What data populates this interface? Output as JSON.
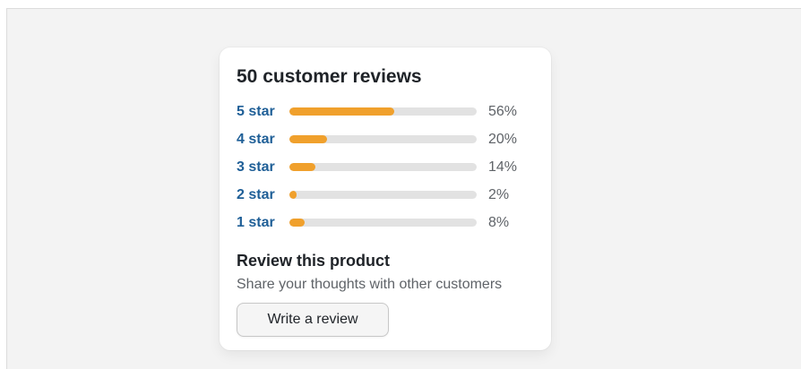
{
  "reviews": {
    "title": "50 customer reviews",
    "accent_color": "#f0a02c",
    "track_color": "#e2e2e2",
    "link_color": "#1f5f97",
    "rows": [
      {
        "label": "5 star",
        "percent": 56,
        "percent_text": "56%"
      },
      {
        "label": "4 star",
        "percent": 20,
        "percent_text": "20%"
      },
      {
        "label": "3 star",
        "percent": 14,
        "percent_text": "14%"
      },
      {
        "label": "2 star",
        "percent": 2,
        "percent_text": "2%"
      },
      {
        "label": "1 star",
        "percent": 8,
        "percent_text": "8%"
      }
    ]
  },
  "review_cta": {
    "heading": "Review this product",
    "subtext": "Share your thoughts with other customers",
    "button_label": "Write a review"
  }
}
